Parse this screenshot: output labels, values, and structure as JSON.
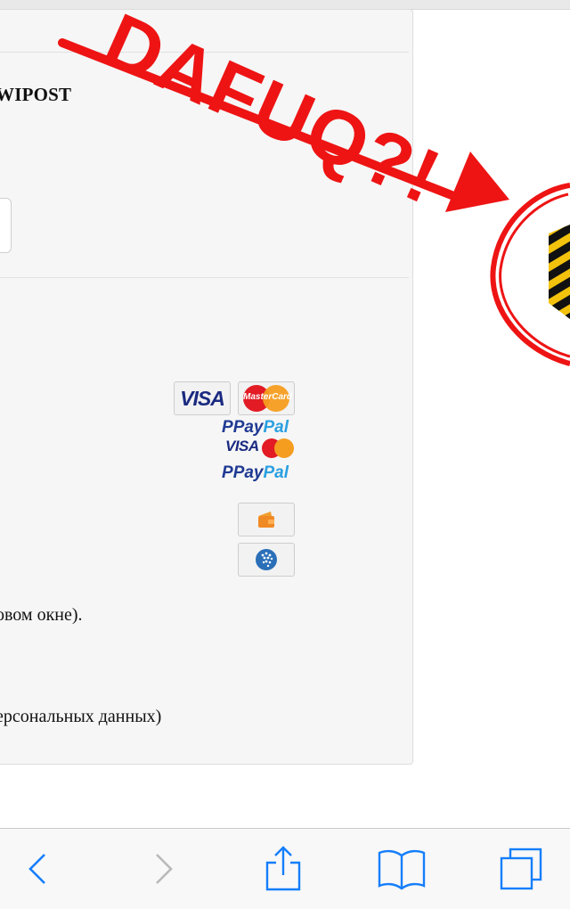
{
  "top_bar": {},
  "checkout": {
    "shipping_title": "WIPOST",
    "payment_methods": [
      {
        "name": "visa-icon",
        "label": "VISA"
      },
      {
        "name": "mastercard-icon",
        "label": "MasterCard"
      },
      {
        "name": "paypal-icon",
        "label_p": "P",
        "label_pay": "Pay",
        "label_pal": "Pal"
      },
      {
        "name": "visa-small-icon",
        "label": "VISA"
      },
      {
        "name": "yandex-wallet-icon"
      },
      {
        "name": "webmoney-icon"
      }
    ],
    "new_window_note": "овом окне).",
    "personal_data_note": "ерсональных данных)"
  },
  "annotation": {
    "text": "DAFUQ?!",
    "color": "#ee1414"
  },
  "toolbar": {
    "items": [
      "back-icon",
      "forward-icon",
      "share-icon",
      "bookmarks-icon",
      "tabs-icon"
    ],
    "accent": "#157efb",
    "disabled": "#b9b9b9"
  }
}
